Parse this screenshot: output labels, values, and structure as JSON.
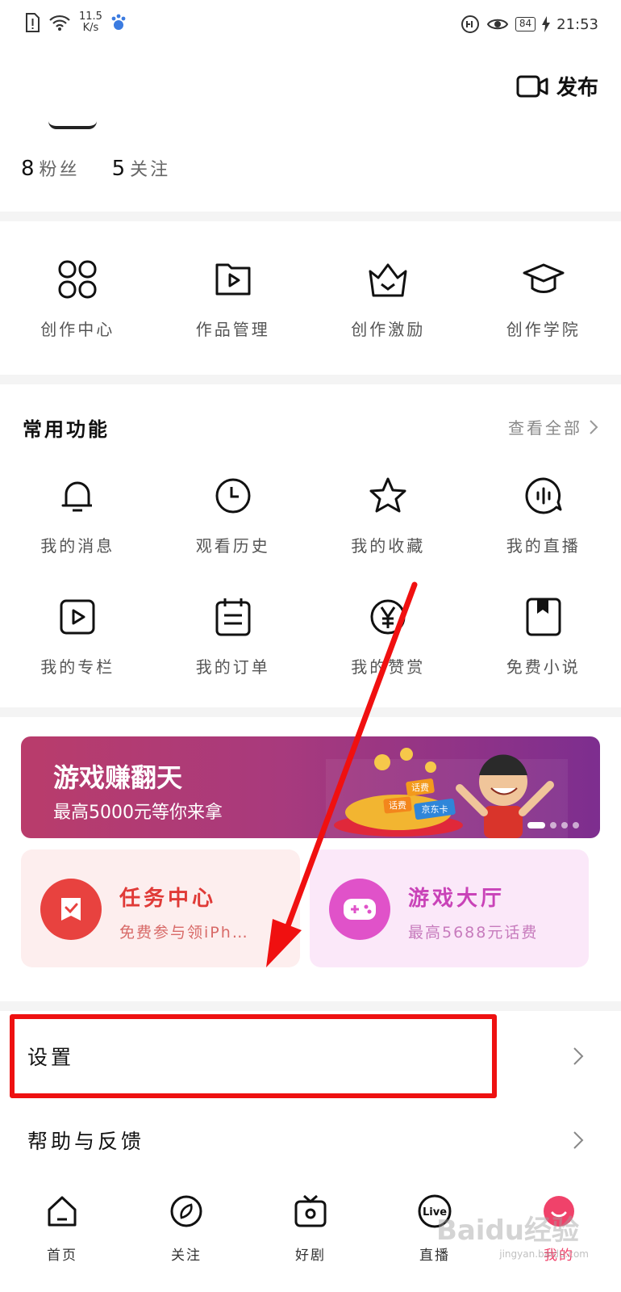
{
  "status_bar": {
    "net_speed_value": "11.5",
    "net_speed_unit": "K/s",
    "battery": "84",
    "time": "21:53"
  },
  "header": {
    "publish_label": "发布"
  },
  "profile": {
    "fans_count": "8",
    "fans_label": "粉丝",
    "follow_count": "5",
    "follow_label": "关注"
  },
  "creator_grid": [
    {
      "label": "创作中心",
      "icon": "grid-icon"
    },
    {
      "label": "作品管理",
      "icon": "video-folder-icon"
    },
    {
      "label": "创作激励",
      "icon": "crown-icon"
    },
    {
      "label": "创作学院",
      "icon": "graduation-cap-icon"
    }
  ],
  "common_functions": {
    "title": "常用功能",
    "view_all": "查看全部",
    "items": [
      {
        "label": "我的消息",
        "icon": "bell-icon"
      },
      {
        "label": "观看历史",
        "icon": "clock-icon"
      },
      {
        "label": "我的收藏",
        "icon": "star-icon"
      },
      {
        "label": "我的直播",
        "icon": "live-audio-icon"
      },
      {
        "label": "我的专栏",
        "icon": "play-square-icon"
      },
      {
        "label": "我的订单",
        "icon": "order-list-icon"
      },
      {
        "label": "我的赞赏",
        "icon": "yen-icon"
      },
      {
        "label": "免费小说",
        "icon": "bookmark-book-icon"
      }
    ]
  },
  "banner": {
    "title": "游戏赚翻天",
    "subtitle": "最高5000元等你来拿",
    "art_labels": [
      "话费",
      "话费",
      "京东卡"
    ]
  },
  "cards": {
    "task": {
      "title": "任务中心",
      "subtitle": "免费参与领iPh…",
      "color": "#e8423f"
    },
    "game": {
      "title": "游戏大厅",
      "subtitle": "最高5688元话费",
      "color": "#e052c9"
    }
  },
  "list": {
    "settings": "设置",
    "help": "帮助与反馈"
  },
  "bottom_nav": [
    {
      "label": "首页",
      "icon": "home-icon"
    },
    {
      "label": "关注",
      "icon": "compass-icon"
    },
    {
      "label": "好剧",
      "icon": "tv-icon"
    },
    {
      "label": "直播",
      "icon": "live-icon"
    },
    {
      "label": "我的",
      "icon": "profile-icon",
      "active": true
    }
  ],
  "watermark": {
    "text": "Baidu经验",
    "sub": "jingyan.baidu.com"
  },
  "colors": {
    "accent": "#f0426a",
    "highlight": "#ee1111"
  }
}
